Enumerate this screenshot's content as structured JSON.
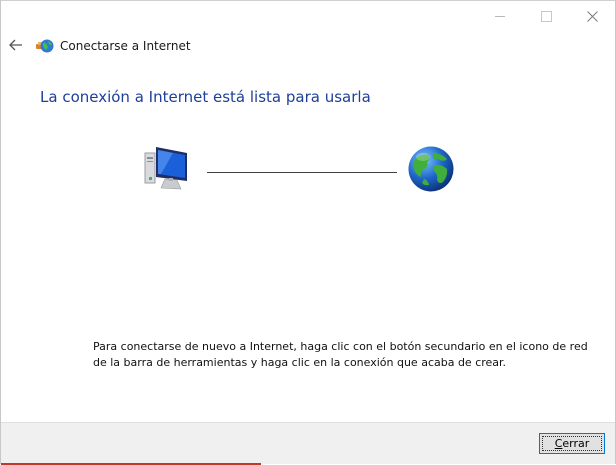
{
  "window": {
    "title": "Conectarse a Internet",
    "minimize_icon": "minimize-icon",
    "maximize_icon": "maximize-icon",
    "close_icon": "close-icon"
  },
  "header": {
    "back_icon": "back-arrow-icon",
    "app_icon": "network-connection-icon",
    "title": "Conectarse a Internet"
  },
  "main": {
    "heading": "La conexión a Internet está lista para usarla",
    "left_icon": "computer-icon",
    "right_icon": "globe-icon",
    "info_text": "Para conectarse de nuevo a Internet, haga clic con el botón secundario en el icono de red de la barra de herramientas y haga clic en la conexión que acaba de crear."
  },
  "footer": {
    "close_button_label": "Cerrar",
    "close_button_mnemonic": "C",
    "close_button_rest": "errar"
  },
  "colors": {
    "heading": "#1d3f9a",
    "footer_bg": "#f0f0f0",
    "focus_border": "#0078d7"
  }
}
